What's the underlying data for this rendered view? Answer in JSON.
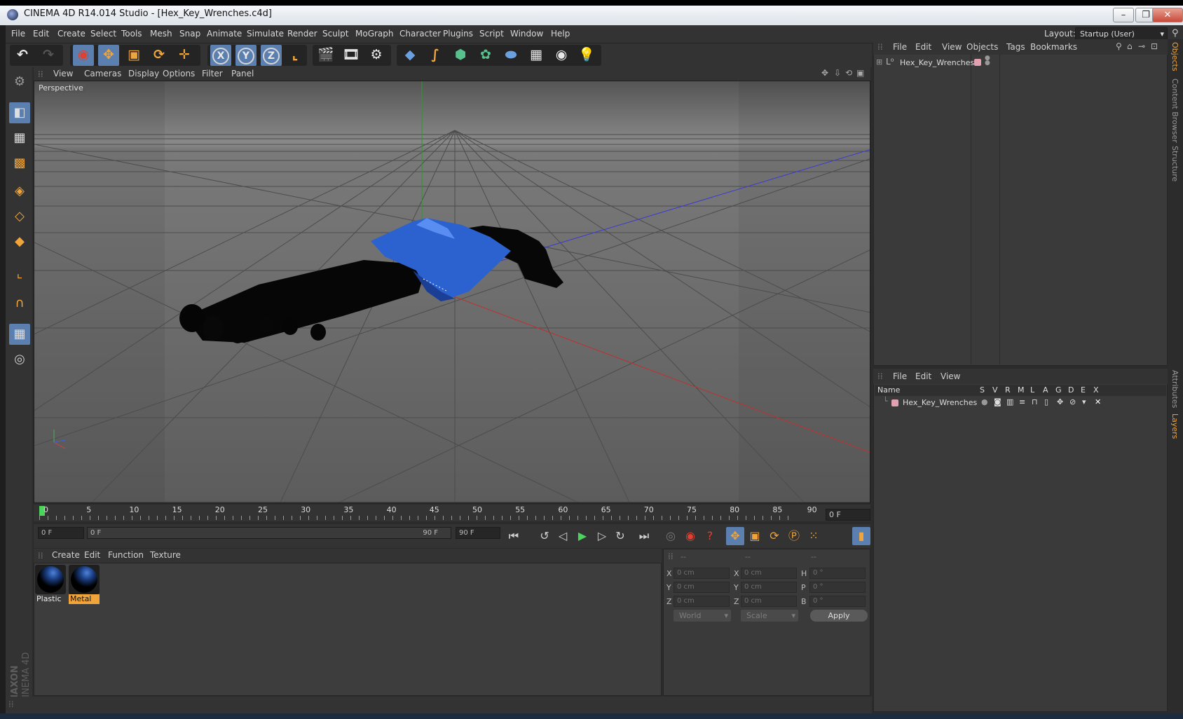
{
  "window": {
    "title": "CINEMA 4D R14.014 Studio - [Hex_Key_Wrenches.c4d]",
    "controls": {
      "minimize": "–",
      "maximize": "❐",
      "close": "✕"
    }
  },
  "menubar": {
    "items": [
      "File",
      "Edit",
      "Create",
      "Select",
      "Tools",
      "Mesh",
      "Snap",
      "Animate",
      "Simulate",
      "Render",
      "Sculpt",
      "MoGraph",
      "Character",
      "Plugins",
      "Script",
      "Window",
      "Help"
    ],
    "layout_label": "Layout:",
    "layout_value": "Startup (User)"
  },
  "toolbar": {
    "axis_x": "X",
    "axis_y": "Y",
    "axis_z": "Z"
  },
  "viewport": {
    "menu": [
      "View",
      "Cameras",
      "Display",
      "Options",
      "Filter",
      "Panel"
    ],
    "label": "Perspective"
  },
  "timeline": {
    "ticks": [
      "0",
      "5",
      "10",
      "15",
      "20",
      "25",
      "30",
      "35",
      "40",
      "45",
      "50",
      "55",
      "60",
      "65",
      "70",
      "75",
      "80",
      "85",
      "90"
    ],
    "current_frame": "0 F",
    "start_field": "0 F",
    "range_start": "0 F",
    "range_end": "90 F",
    "end_field": "90 F"
  },
  "materials": {
    "menu": [
      "Create",
      "Edit",
      "Function",
      "Texture"
    ],
    "items": [
      {
        "name": "Plastic",
        "selected": false
      },
      {
        "name": "Metal",
        "selected": true
      }
    ]
  },
  "coordinates": {
    "headers": [
      "--",
      "--",
      "--"
    ],
    "rows": [
      {
        "l1": "X",
        "v1": "0 cm",
        "l2": "X",
        "v2": "0 cm",
        "l3": "H",
        "v3": "0 °"
      },
      {
        "l1": "Y",
        "v1": "0 cm",
        "l2": "Y",
        "v2": "0 cm",
        "l3": "P",
        "v3": "0 °"
      },
      {
        "l1": "Z",
        "v1": "0 cm",
        "l2": "Z",
        "v2": "0 cm",
        "l3": "B",
        "v3": "0 °"
      }
    ],
    "mode1": "World",
    "mode2": "Scale",
    "apply": "Apply"
  },
  "object_manager": {
    "menu": [
      "File",
      "Edit",
      "View",
      "Objects",
      "Tags",
      "Bookmarks"
    ],
    "object_name": "Hex_Key_Wrenches"
  },
  "layer_manager": {
    "menu": [
      "File",
      "Edit",
      "View"
    ],
    "columns": [
      "Name",
      "S",
      "V",
      "R",
      "M",
      "L",
      "A",
      "G",
      "D",
      "E",
      "X"
    ],
    "layer_name": "Hex_Key_Wrenches"
  },
  "right_tabs": [
    "Objects",
    "Content Browser",
    "Structure",
    "Attributes",
    "Layers"
  ],
  "brand": {
    "line1": "MAXON",
    "line2": "CINEMA 4D"
  },
  "colors": {
    "accent": "#f0a43a",
    "active": "#5b80b0",
    "object_blue": "#2b62cf"
  }
}
